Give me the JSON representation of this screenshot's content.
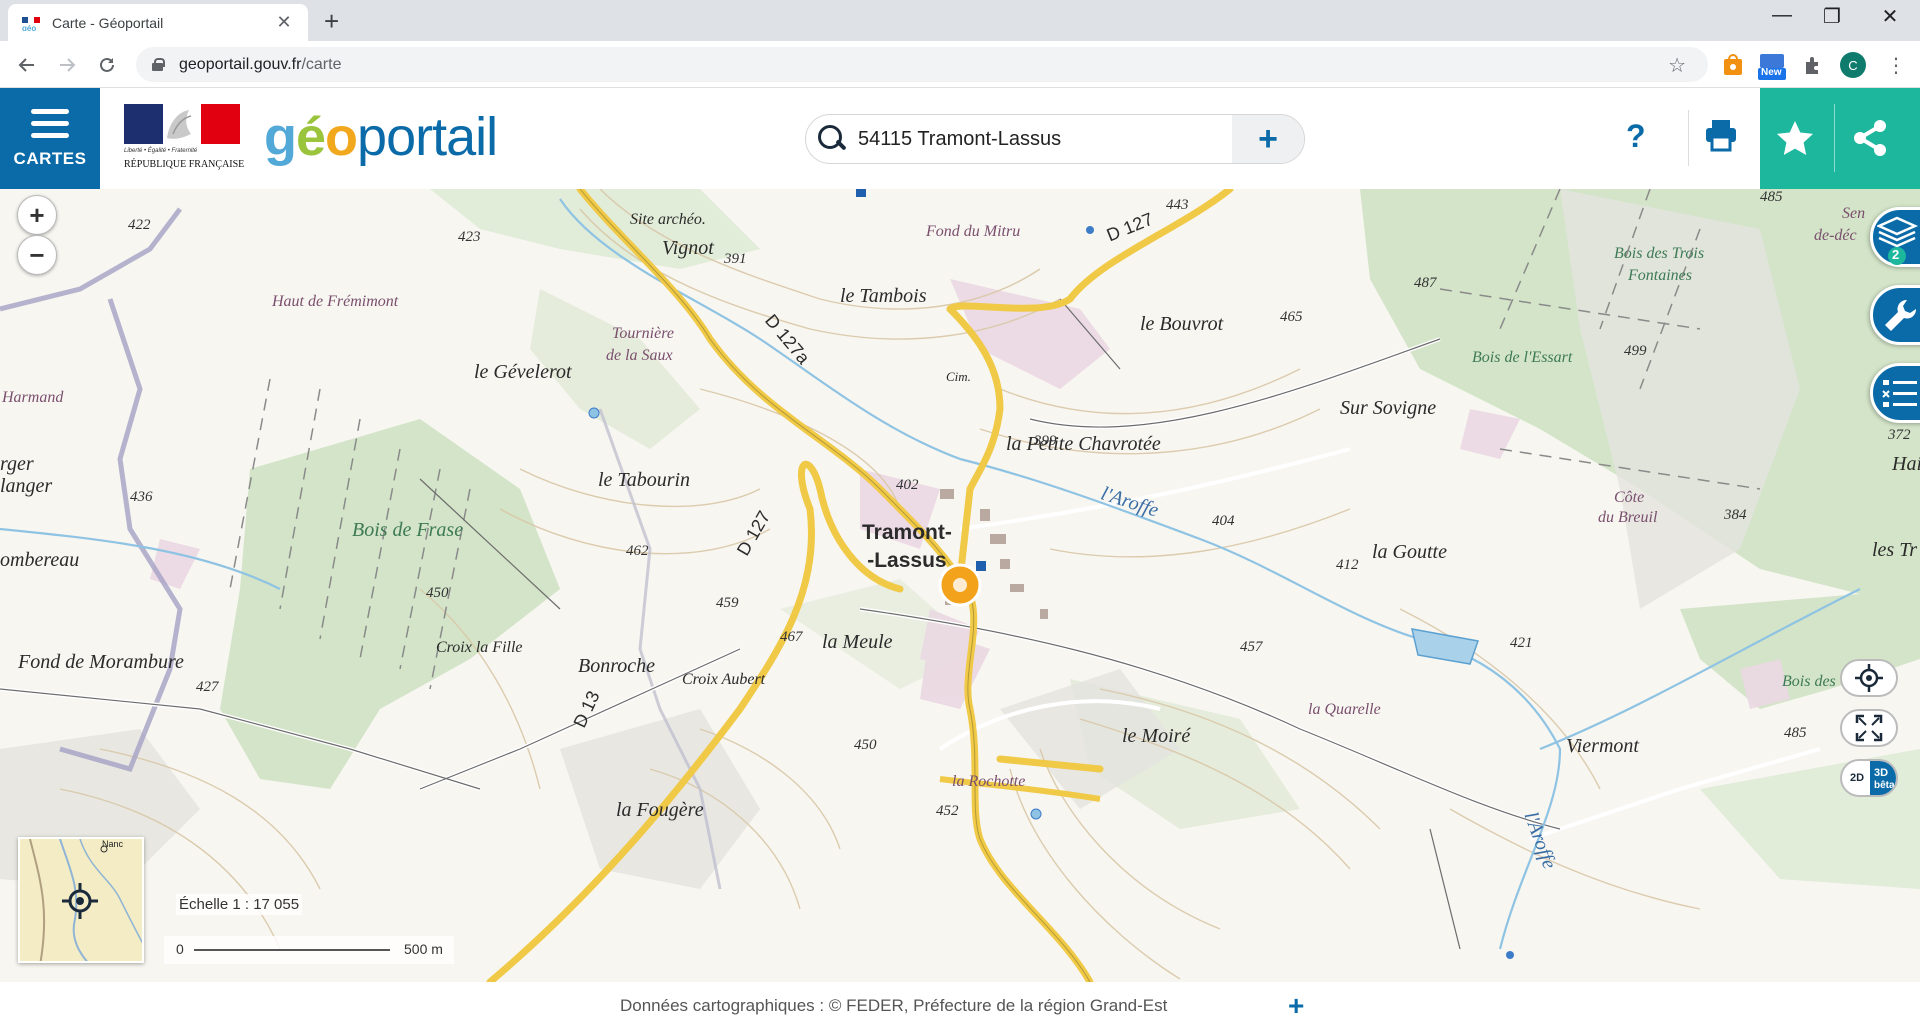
{
  "browser": {
    "tab_title": "Carte - Géoportail",
    "tab_close": "✕",
    "new_tab": "+",
    "url_host": "geoportail.gouv.fr",
    "url_path": "/carte",
    "ext_new_badge": "New",
    "profile_initial": "C",
    "window_controls": {
      "minimize": "—",
      "maximize": "❐",
      "close": "✕"
    }
  },
  "header": {
    "menu_label": "CARTES",
    "devise": "Liberté • Égalité • Fraternité",
    "republique": "RÉPUBLIQUE FRANÇAISE",
    "logo": {
      "part1": "g",
      "part2": "é",
      "part3": "o",
      "part4": "portail"
    },
    "search_value": "54115 Tramont-Lassus",
    "search_add": "+",
    "help": "?",
    "accent_color": "#1db79e",
    "primary_color": "#0b6ba8"
  },
  "map": {
    "zoom_in": "+",
    "zoom_out": "−",
    "scale_text": "Échelle 1 : 17 055",
    "scale_min": "0",
    "scale_max": "500 m",
    "layers_count": "2",
    "view_2d": "2D",
    "view_3d": "3D",
    "view_3d_sub": "bêta",
    "village": {
      "line1": "Tramont-",
      "line2": "-Lassus"
    },
    "places": [
      "Site archéo.",
      "Vignot",
      "Fond du Mitru",
      "le Tambois",
      "le Bouvrot",
      "Haut de Frémimont",
      "Tournière",
      "de la Saux",
      "le Gévelerot",
      "Harmand",
      "Cim.",
      "la Petite Chavrotée",
      "Sur Sovigne",
      "le Tabourin",
      "Bois de Frase",
      "l'Aroffe",
      "la Goutte",
      "Côte",
      "du Breuil",
      "les Tr",
      "la Meule",
      "Bonroche",
      "Croix la Fille",
      "Croix Aubert",
      "Fond de Morambure",
      "le Moiré",
      "la Quarelle",
      "Viermont",
      "la Rochotte",
      "la Fougère",
      "Bois des Trois",
      "Fontaines",
      "Bois de l'Essart",
      "Bois des Conrot",
      "l'Aroffe",
      "rger",
      "langer",
      "ombereau",
      "Hai",
      "Sen",
      "de-déc"
    ],
    "roads": [
      "D 127",
      "D 127a",
      "D 127",
      "D 13"
    ],
    "elevations": [
      "422",
      "423",
      "391",
      "443",
      "485",
      "487",
      "465",
      "499",
      "402",
      "399",
      "436",
      "462",
      "459",
      "467",
      "404",
      "412",
      "457",
      "421",
      "384",
      "372",
      "427",
      "450",
      "452",
      "485",
      "450"
    ]
  },
  "footer": {
    "attribution": "Données cartographiques : ©     FEDER,  Préfecture de la région Grand-Est",
    "more": "+"
  }
}
